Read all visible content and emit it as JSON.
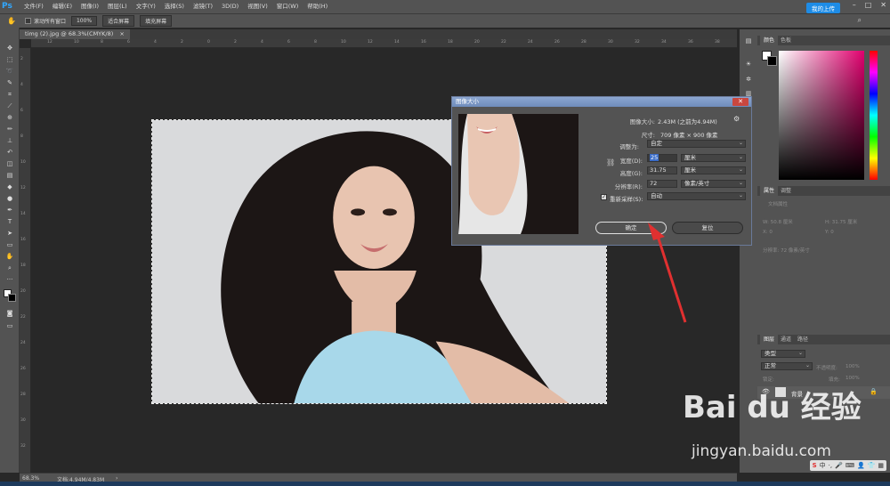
{
  "app": {
    "logo": "Ps"
  },
  "menu": [
    "文件(F)",
    "编辑(E)",
    "图像(I)",
    "图层(L)",
    "文字(Y)",
    "选择(S)",
    "滤镜(T)",
    "3D(D)",
    "视图(V)",
    "窗口(W)",
    "帮助(H)"
  ],
  "window_controls": {
    "minimize": "–",
    "maximize": "□",
    "close": "✕"
  },
  "options": {
    "scroll_all": "滚动所有窗口",
    "zoom_100": "100%",
    "fit_screen": "适合屏幕",
    "fill_screen": "填充屏幕",
    "share": "我的上传"
  },
  "document": {
    "tab_title": "timg (2).jpg @ 68.3%(CMYK/8)"
  },
  "ruler_h": [
    "12",
    "10",
    "8",
    "6",
    "4",
    "2",
    "0",
    "2",
    "4",
    "6",
    "8",
    "10",
    "12",
    "14",
    "16",
    "18",
    "20",
    "22",
    "24",
    "26",
    "28",
    "30",
    "32",
    "34",
    "36",
    "38"
  ],
  "dialog": {
    "title": "图像大小",
    "image_size_label": "图像大小:",
    "image_size_value": "2.43M (之前为4.94M)",
    "dimensions_label": "尺寸:",
    "dimensions_value": "709 像素 × 900 像素",
    "fit_label": "调整为:",
    "fit_value": "自定",
    "width_label": "宽度(D):",
    "width_value": "25",
    "width_unit": "厘米",
    "height_label": "高度(G):",
    "height_value": "31.75",
    "height_unit": "厘米",
    "resolution_label": "分辨率(R):",
    "resolution_value": "72",
    "resolution_unit": "像素/英寸",
    "resample_label": "重新采样(S):",
    "resample_value": "自动",
    "ok": "确定",
    "reset": "复位"
  },
  "panels": {
    "color_tab": "颜色",
    "swatches_tab": "色板",
    "properties_tab": "属性",
    "adjust_tab": "调整",
    "doc_props": "文档属性",
    "w_label": "W: 50.8 厘米",
    "h_label": "H: 31.75 厘米",
    "x_label": "X: 0",
    "y_label": "Y: 0",
    "resolution_info": "分辨率: 72 像素/英寸",
    "layers_tab": "图层",
    "channels_tab": "通道",
    "paths_tab": "路径",
    "kind_label": "类型",
    "blend_mode": "正常",
    "opacity_label": "不透明度:",
    "opacity_value": "100%",
    "lock_label": "锁定:",
    "fill_label": "填充:",
    "fill_value": "100%",
    "layer_name": "背景"
  },
  "status": {
    "zoom": "68.3%",
    "doc": "文档:4.94M/4.83M"
  },
  "watermark": {
    "brand": "Bai du 经验",
    "url": "jingyan.baidu.com"
  },
  "tray": {
    "ime": "中",
    "punct": "·,",
    "mic": "🎤"
  },
  "colors": {
    "accent": "#31a8ff",
    "share": "#1e8ce6",
    "close": "#c9473f",
    "arrow": "#e03030"
  }
}
